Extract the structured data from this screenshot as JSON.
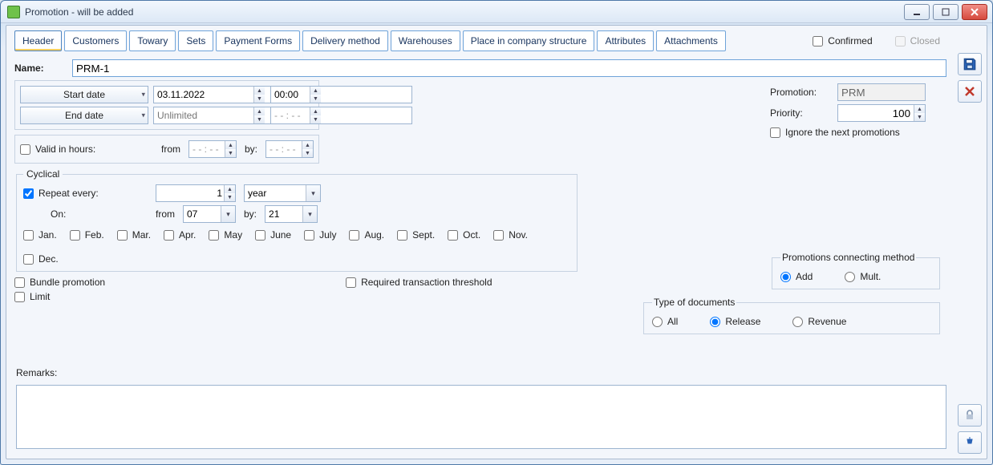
{
  "window": {
    "title": "Promotion - will be added"
  },
  "tabs": {
    "header": "Header",
    "customers": "Customers",
    "towary": "Towary",
    "sets": "Sets",
    "payment": "Payment Forms",
    "delivery": "Delivery method",
    "warehouses": "Warehouses",
    "place": "Place in company structure",
    "attributes": "Attributes",
    "attachments": "Attachments"
  },
  "topchecks": {
    "confirmed": "Confirmed",
    "closed": "Closed"
  },
  "name": {
    "label": "Name:",
    "value": "PRM-1"
  },
  "dates": {
    "start_btn": "Start date",
    "end_btn": "End date",
    "start_date": "03.11.2022",
    "start_time": "00:00",
    "end_date_placeholder": "Unlimited",
    "end_time": "- - : - -"
  },
  "valid": {
    "label": "Valid in hours:",
    "from": "from",
    "by": "by:",
    "from_val": "- - : - -",
    "by_val": "- - : - -"
  },
  "cyclical": {
    "legend": "Cyclical",
    "repeat_label": "Repeat every:",
    "repeat_value": "1",
    "unit": "year",
    "on_label": "On:",
    "from_label": "from",
    "from_val": "07",
    "by_label": "by:",
    "by_val": "21",
    "months": {
      "jan": "Jan.",
      "feb": "Feb.",
      "mar": "Mar.",
      "apr": "Apr.",
      "may": "May",
      "june": "June",
      "july": "July",
      "aug": "Aug.",
      "sept": "Sept.",
      "oct": "Oct.",
      "nov": "Nov.",
      "dec": "Dec."
    }
  },
  "flags": {
    "bundle": "Bundle promotion",
    "limit": "Limit",
    "required_threshold": "Required transaction threshold"
  },
  "right": {
    "promotion_label": "Promotion:",
    "promotion_value": "PRM",
    "priority_label": "Priority:",
    "priority_value": "100",
    "ignore": "Ignore the next promotions"
  },
  "connect": {
    "legend": "Promotions connecting method",
    "add": "Add",
    "mult": "Mult."
  },
  "docs": {
    "legend": "Type of documents",
    "all": "All",
    "release": "Release",
    "revenue": "Revenue"
  },
  "remarks": {
    "label": "Remarks:"
  }
}
